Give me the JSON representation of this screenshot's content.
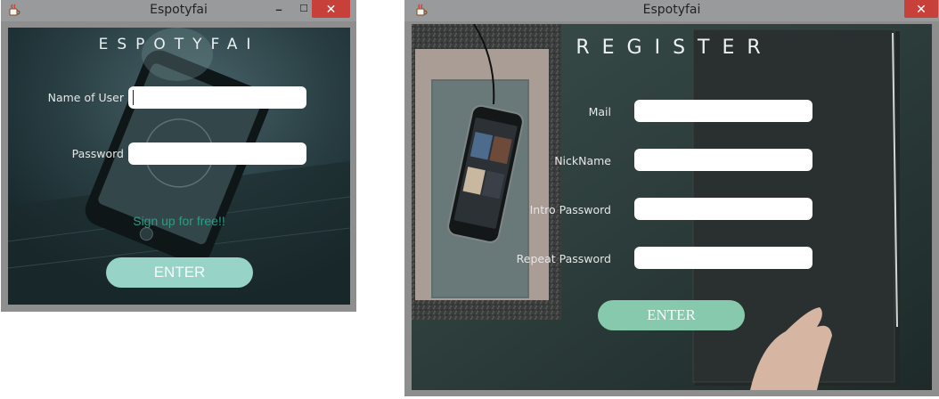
{
  "login_window": {
    "title": "Espotyfai",
    "controls": {
      "minimize": "–",
      "maximize": "☐",
      "close": "✕"
    },
    "heading": "ESPOTYFAI",
    "username_label": "Name of User",
    "username_value": "",
    "password_label": "Password",
    "password_value": "",
    "signup_link": "Sign up for free!!",
    "enter_button": "ENTER"
  },
  "register_window": {
    "title": "Espotyfai",
    "controls": {
      "close": "✕"
    },
    "heading": "REGISTER",
    "fields": [
      {
        "label": "Mail",
        "value": ""
      },
      {
        "label": "NickName",
        "value": ""
      },
      {
        "label": "Intro Password",
        "value": ""
      },
      {
        "label": "Repeat Password",
        "value": ""
      }
    ],
    "enter_button": "ENTER"
  },
  "colors": {
    "accent_button": "#97d3c7",
    "signup_link": "#2e9b86",
    "close_button": "#c8403a",
    "titlebar": "#999a9c"
  },
  "icons": {
    "app_icon": "java-cup-icon"
  }
}
